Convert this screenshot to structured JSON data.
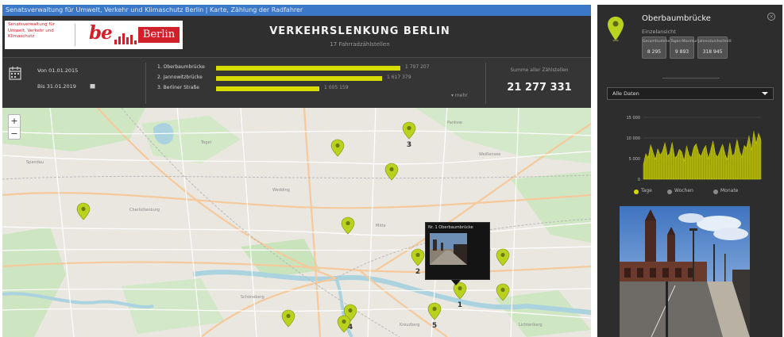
{
  "window": {
    "title": "Senatsverwaltung für Umwelt, Verkehr und Klimaschutz Berlin | Karte, Zählung der Radfahrer"
  },
  "header": {
    "logo": {
      "org_text": "Senatsverwaltung für Umwelt, Verkehr und Klimaschutz",
      "brand_be": "be",
      "brand_berlin": "Berlin"
    },
    "title": "VERKEHRSLENKUNG BERLIN",
    "subtitle": "17 Fahrradzählstellen"
  },
  "stats": {
    "date_from": "Von 01.01.2015",
    "date_to": "Bis 31.01.2019",
    "ranking": [
      {
        "label": "1. Oberbaumbrücke",
        "value": "1 797 207",
        "fraction": 1.0
      },
      {
        "label": "2. Jannowitzbrücke",
        "value": "1 617 379",
        "fraction": 0.9
      },
      {
        "label": "3. Berliner Straße",
        "value": "1 005 159",
        "fraction": 0.56
      }
    ],
    "more_label": "▾ mehr",
    "sum_label": "Summe aller Zählstellen",
    "sum_value": "21 277 331"
  },
  "map": {
    "zoom_in": "+",
    "zoom_out": "−",
    "marker_color": "#b9d21e",
    "markers": [
      {
        "name": "marker-3",
        "label": "3",
        "x": 512,
        "y": 38
      },
      {
        "name": "marker-a",
        "label": "",
        "x": 422,
        "y": 60
      },
      {
        "name": "marker-b",
        "label": "",
        "x": 490,
        "y": 90
      },
      {
        "name": "marker-c",
        "label": "",
        "x": 102,
        "y": 140
      },
      {
        "name": "marker-d",
        "label": "",
        "x": 435,
        "y": 158
      },
      {
        "name": "marker-2",
        "label": "2",
        "x": 523,
        "y": 198
      },
      {
        "name": "marker-e",
        "label": "",
        "x": 630,
        "y": 198
      },
      {
        "name": "marker-1",
        "label": "1",
        "x": 576,
        "y": 240
      },
      {
        "name": "marker-f",
        "label": "",
        "x": 630,
        "y": 242
      },
      {
        "name": "marker-5",
        "label": "5",
        "x": 544,
        "y": 266
      },
      {
        "name": "marker-4",
        "label": "4",
        "x": 438,
        "y": 268
      },
      {
        "name": "marker-g",
        "label": "",
        "x": 360,
        "y": 275
      },
      {
        "name": "marker-h",
        "label": "",
        "x": 430,
        "y": 282
      }
    ],
    "popup": {
      "title": "Nr. 1 Oberbaumbrücke"
    }
  },
  "panel": {
    "title": "Oberbaumbrücke",
    "subtitle": "Einzelansicht",
    "stats": [
      {
        "label": "Gesamtsumme",
        "value": "8 295"
      },
      {
        "label": "Tages-Maximum",
        "value": "9 893"
      },
      {
        "label": "Jahresdurchschnitt",
        "value": "318 945"
      }
    ],
    "dropdown_value": "Alle Daten",
    "legend": [
      {
        "label": "Tage",
        "color": "#d7dc00"
      },
      {
        "label": "Wochen",
        "color": "#8a8a8a"
      },
      {
        "label": "Monate",
        "color": "#8a8a8a"
      }
    ]
  },
  "chart_data": {
    "type": "area",
    "title": "",
    "xlabel": "",
    "ylabel": "",
    "ylim": [
      0,
      15000
    ],
    "yticks": [
      "15 000",
      "10 000",
      "5 000",
      "0"
    ],
    "color": "#d7dc00",
    "values": [
      3500,
      6200,
      5200,
      8400,
      6600,
      4800,
      7400,
      5800,
      6800,
      8900,
      5600,
      6300,
      9000,
      5200,
      5700,
      7300,
      6600,
      4400,
      8100,
      5900,
      5200,
      7800,
      8600,
      6400,
      5500,
      7200,
      8200,
      4900,
      6900,
      9300,
      6100,
      5400,
      7000,
      8500,
      6200,
      4700,
      8900,
      5600,
      6300,
      9700,
      7000,
      5300,
      8200,
      7600,
      10600,
      7000,
      11700,
      8600,
      11200,
      9500
    ]
  }
}
